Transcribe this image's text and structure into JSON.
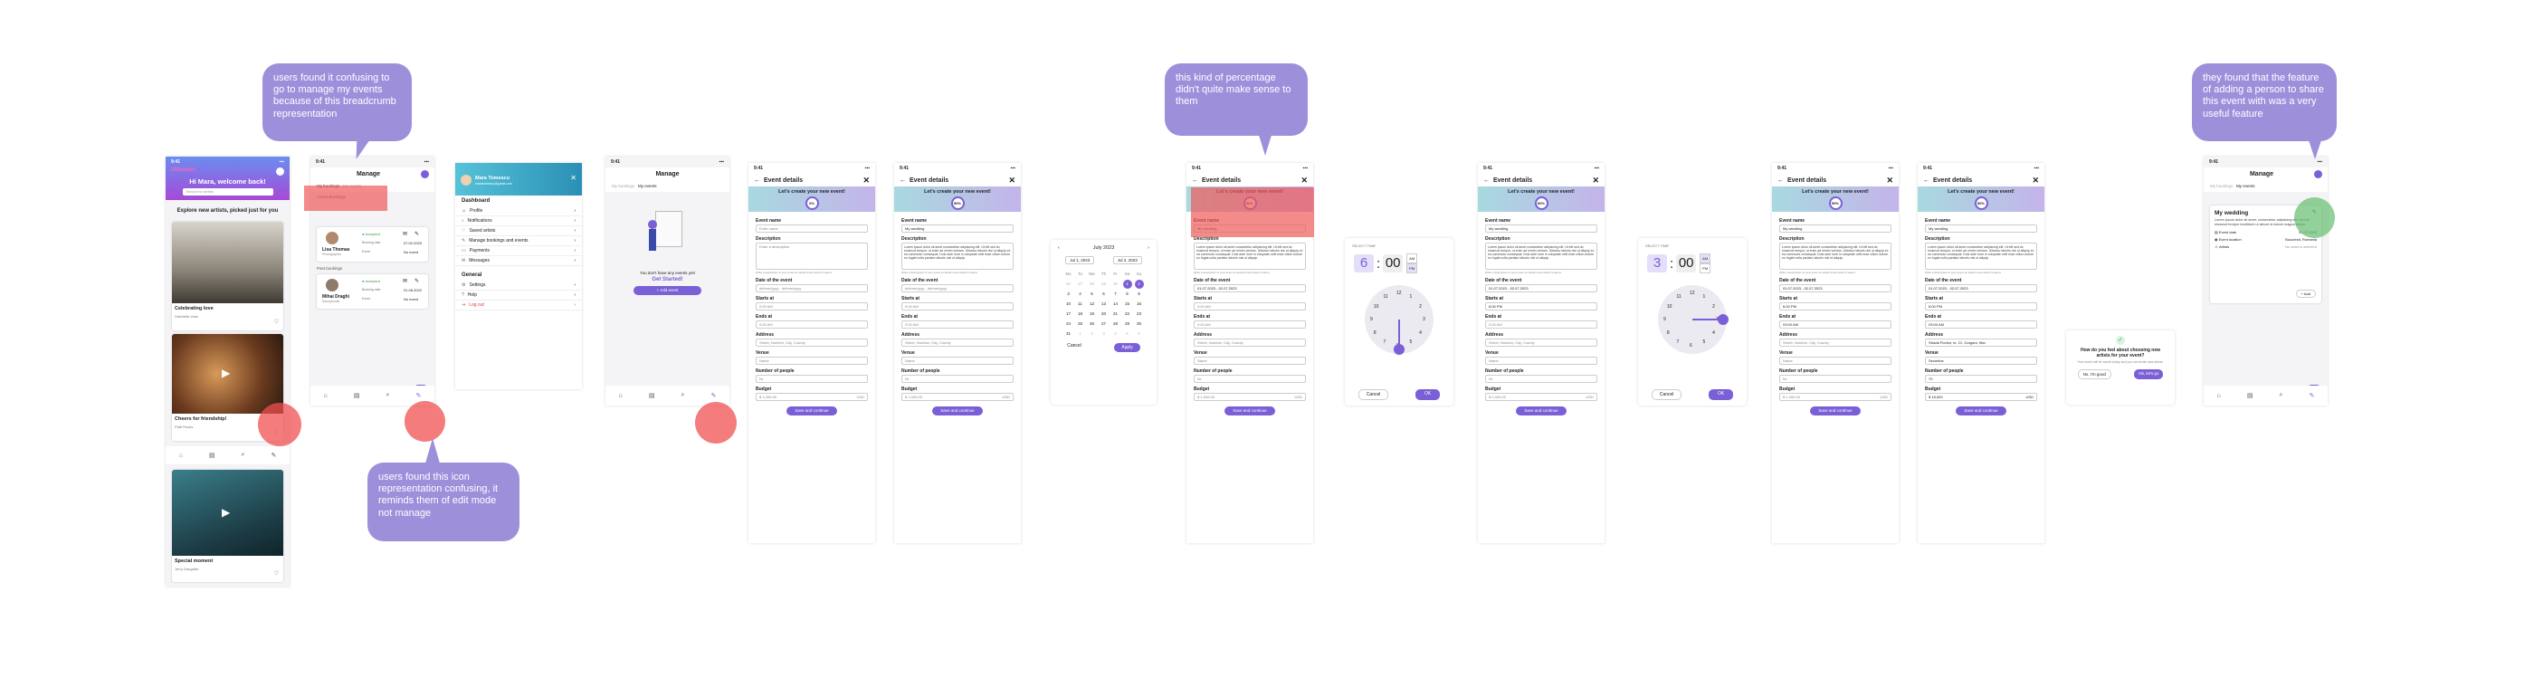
{
  "status_time": "9:41",
  "home": {
    "brand": "Ultimatex",
    "greeting": "Hi Mara, welcome back!",
    "search_placeholder": "Search for artists",
    "explore_heading": "Explore new artists, picked just for you",
    "cards": [
      {
        "title": "Celebrating love",
        "name": "Gabriella Voss",
        "role": "Photographer"
      },
      {
        "title": "Cheers for friendship!",
        "name": "Patti Rocks",
        "role": "Videographer"
      },
      {
        "title": "Special moment",
        "name": "Jerry Daughter",
        "role": "Violinist"
      }
    ]
  },
  "manage": {
    "title": "Manage",
    "crumb_a": "My bookings",
    "crumb_b": "My events",
    "active_label": "Active Bookings",
    "past_label": "Past bookings",
    "accepted": "Accepted",
    "bookings": [
      {
        "name": "Lisa Thomas",
        "role": "Photographer",
        "date": "07.02.2023",
        "event": "No event",
        "ev_label": "Event",
        "bk_label": "Booking date"
      },
      {
        "name": "Mihai Draghi",
        "role": "Saxophonist",
        "date": "01.08.2022",
        "event": "No event",
        "ev_label": "Event",
        "bk_label": "Booking date"
      }
    ]
  },
  "drawer": {
    "user_name": "Mara Tomescu",
    "user_email": "maratomescu@gmail.com",
    "dashboard": "Dashboard",
    "items": [
      "Profile",
      "Notifications",
      "Saved artists",
      "Manage bookings and events",
      "Payments",
      "Messages"
    ],
    "general": "General",
    "general_items": [
      "Settings",
      "Help",
      "Log out"
    ]
  },
  "empty": {
    "title": "Manage",
    "text": "You don't have any events yet!",
    "cta": "Get Started!",
    "button": "Add event"
  },
  "event": {
    "title": "Event details",
    "banner": "Let's create your new event!",
    "pct_empty": "0%",
    "pct": "50%",
    "labels": {
      "name": "Event name",
      "desc": "Description",
      "date": "Date of the event",
      "starts": "Starts at",
      "ends": "Ends at",
      "address": "Address",
      "venue": "Venue",
      "people": "Number of people",
      "budget": "Budget"
    },
    "placeholders": {
      "name": "Enter name",
      "desc": "Enter a description",
      "date": "dd/mm/yyyy  -  dd/mm/yyyy",
      "time": "0:00 AM",
      "address": "Street, Number, City, County",
      "venue": "Name",
      "people": "Nr.",
      "budget": "1,000.00",
      "currency": "USD"
    },
    "filled_name": "My wedding",
    "filled_desc": "Lorem ipsum dolor sit amet consectetur adipiscing elit. Ut elit sed do eiusmod tempor, ut enim ad minim veniam. Ullamco laboris nisi ut aliquip ex ea commodo consequat. Duis aute irure in voluptate velit esse cillum dolore eu fugiat nulla pariatur laboris nisi ut aliquip.",
    "filled_date": "01.07.2023 - 02.07.2023",
    "time_start": "6:00 PM",
    "time_end": "03:00 AM",
    "address": "Strada Florilor, nr. 21, Gorgani, Ilfov",
    "venue": "Secretive",
    "people": "70",
    "budget_full": "15,000",
    "hint": "Write a description of your event so artists know what it's about.",
    "save": "Save and continue"
  },
  "calendar": {
    "month": "July 2023",
    "from": "Jul 1, 2023",
    "to": "Jul 2, 2023",
    "weekdays": [
      "Mo",
      "Tu",
      "We",
      "Th",
      "Fr",
      "Sa",
      "Su"
    ],
    "rows": [
      [
        "26",
        "27",
        "28",
        "29",
        "30",
        "1",
        "2"
      ],
      [
        "3",
        "4",
        "5",
        "6",
        "7",
        "8",
        "9"
      ],
      [
        "10",
        "11",
        "12",
        "13",
        "14",
        "15",
        "16"
      ],
      [
        "17",
        "18",
        "19",
        "20",
        "21",
        "22",
        "23"
      ],
      [
        "24",
        "25",
        "26",
        "27",
        "28",
        "29",
        "30"
      ],
      [
        "31",
        "1",
        "2",
        "3",
        "4",
        "5",
        "6"
      ]
    ],
    "cancel": "Cancel",
    "apply": "Apply"
  },
  "timepicker": {
    "label": "SELECT TIME",
    "h1": "6",
    "h2": "3",
    "m": "00",
    "am": "AM",
    "pm": "PM",
    "cancel": "Cancel",
    "ok": "OK",
    "nums": [
      "12",
      "1",
      "2",
      "3",
      "4",
      "5",
      "6",
      "7",
      "8",
      "9",
      "10",
      "11"
    ]
  },
  "survey": {
    "question": "How do you feel about choosing new artists for your event?",
    "sub": "Your event will be saved today and you can invite new artists.",
    "no": "No, I'm good",
    "yes": "Ok, let's go"
  },
  "final": {
    "title": "Manage",
    "crumb_a": "My bookings",
    "crumb_b": "My events",
    "event_title": "My wedding",
    "desc": "Lorem ipsum dolor sit amet, consectetur adipiscing elit, sed do eiusmod tempor incididunt ut labore et dolore magna aliqua.",
    "date_label": "Event date",
    "date": "01.07.2023",
    "loc_label": "Event location",
    "loc": "Bucuresti, Romania",
    "artists_label": "Artists",
    "artists_val": "No artist is selected",
    "add": "Add"
  },
  "bubbles": {
    "b1": "users found it confusing to go to manage my events because of this breadcrumb representation",
    "b2": "users found this icon representation confusing, it reminds them of edit mode not manage",
    "b3": "this kind of percentage didn't quite make sense to them",
    "b4": "they found that the feature of adding a person to share this event with was a very useful feature"
  },
  "colors": {
    "accent": "#7b5fd6",
    "bubble": "#9e8fdb",
    "highlight": "#f05050",
    "positive": "#64be6e"
  }
}
